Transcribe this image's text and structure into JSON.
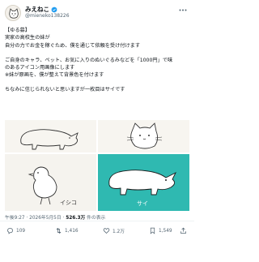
{
  "author": {
    "display_name": "みえねこ",
    "handle": "@mieneko138226",
    "avatar_icon": "cat-avatar-icon"
  },
  "post": {
    "lines": [
      "【ゆる募】",
      "実家の高校生の妹が",
      "自分の力でお金を稼ぐため、僕を通じて依頼を受け付けます",
      "",
      "ご自身のキャラ、ペット、お気に入りのぬいぐるみなどを「1000円」で味",
      "のあるアイコン用画像にします",
      "※妹が原画を、僕が整えて背景色を付けます",
      "",
      "ちなみに信じられないと思いますが一枚目はサイです"
    ]
  },
  "images": [
    {
      "name": "rhino-drawing",
      "bg": "#f7f5f0"
    },
    {
      "name": "cat-drawing",
      "bg": "#f7f5f0"
    },
    {
      "name": "chick-drawing",
      "bg": "#f5f3ee",
      "caption": "イシコ"
    },
    {
      "name": "rhino-teal-drawing",
      "bg": "#2fb9b1",
      "caption": "サイ"
    }
  ],
  "meta": {
    "time": "午後9:27 · 2026年5月5日 · ",
    "views_count": "526.3万",
    "views_label": " 件の表示"
  },
  "actions": {
    "reply": "109",
    "repost": "1,416",
    "like": "1.2万",
    "bookmark": "1,549"
  },
  "colors": {
    "text": "#0f1419",
    "secondary": "#536471",
    "verified": "#1d9bf0",
    "teal_bg": "#2fb9b1"
  }
}
